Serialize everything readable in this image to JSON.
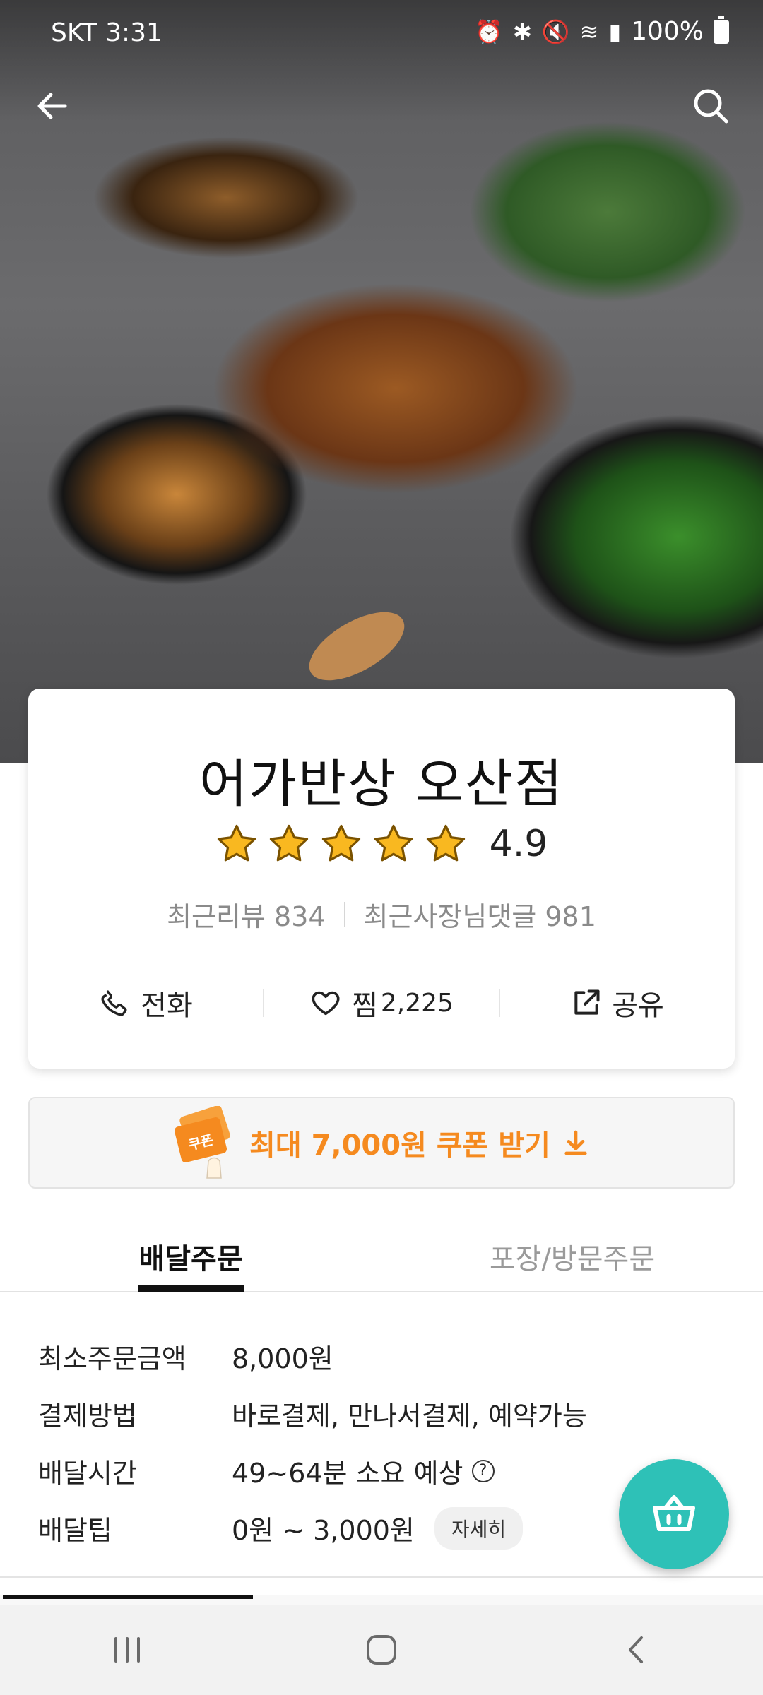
{
  "status": {
    "time": "SKT 3:31",
    "battery": "100%"
  },
  "store": {
    "name": "어가반상 오산점",
    "rating": "4.9",
    "stars": 5,
    "recent_reviews": "최근리뷰 834",
    "owner_comments": "최근사장님댓글 981"
  },
  "actions": {
    "call_label": "전화",
    "favorite_label": "찜",
    "favorite_count": "2,225",
    "share_label": "공유"
  },
  "coupon": {
    "badge": "쿠폰",
    "text": "최대 7,000원 쿠폰 받기"
  },
  "tabs": [
    {
      "label": "배달주문",
      "active": true
    },
    {
      "label": "포장/방문주문",
      "active": false
    }
  ],
  "info": {
    "min_order_label": "최소주문금액",
    "min_order_value": "8,000원",
    "payment_label": "결제방법",
    "payment_value": "바로결제, 만나서결제, 예약가능",
    "delivery_time_label": "배달시간",
    "delivery_time_value": "49~64분 소요 예상",
    "delivery_tip_label": "배달팁",
    "delivery_tip_value": "0원 ~ 3,000원",
    "detail_button": "자세히"
  },
  "colors": {
    "accent_orange": "#f58a1f",
    "cart_teal": "#2ec1b7",
    "star": "#f9b820"
  },
  "icons": [
    "back-arrow-icon",
    "search-icon",
    "phone-icon",
    "heart-icon",
    "share-icon",
    "coupon-icon",
    "download-icon",
    "help-icon",
    "cart-icon",
    "recent-apps-icon",
    "home-icon",
    "back-icon"
  ]
}
